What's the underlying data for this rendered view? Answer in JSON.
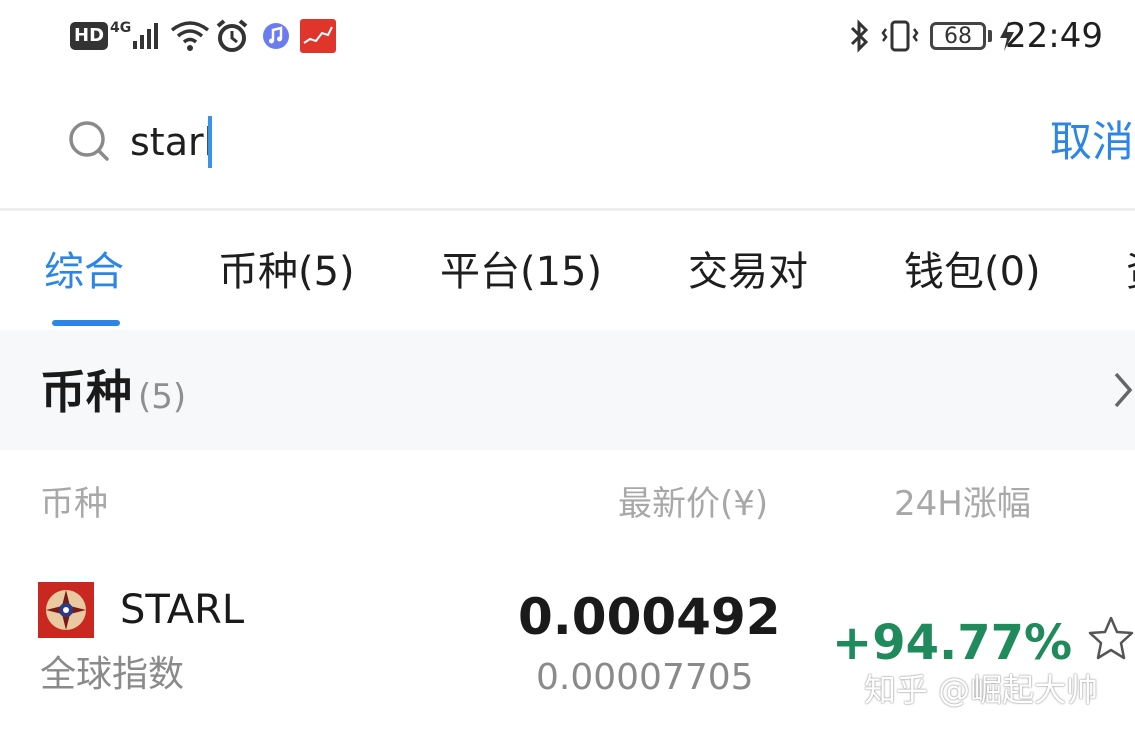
{
  "status_bar": {
    "hd_label": "HD",
    "network_label": "4G",
    "battery": "68",
    "time": "22:49"
  },
  "search": {
    "query": "starl",
    "cancel_label": "取消"
  },
  "tabs": [
    {
      "label": "综合",
      "active": true
    },
    {
      "label": "币种(5)",
      "active": false
    },
    {
      "label": "平台(15)",
      "active": false
    },
    {
      "label": "交易对",
      "active": false
    },
    {
      "label": "钱包(0)",
      "active": false
    },
    {
      "label": "资",
      "active": false
    }
  ],
  "section": {
    "title": "币种",
    "count": "(5)"
  },
  "columns": {
    "coin": "币种",
    "price": "最新价(¥)",
    "change": "24H涨幅"
  },
  "rows": [
    {
      "symbol": "STARL",
      "subtitle": "全球指数",
      "price": "0.000492",
      "price_alt": "0.00007705",
      "change": "+94.77%"
    }
  ],
  "watermark": "知乎 @崛起大帅",
  "colors": {
    "accent": "#2d86e6",
    "positive": "#1f8a5b",
    "status_red": "#e0352b"
  }
}
